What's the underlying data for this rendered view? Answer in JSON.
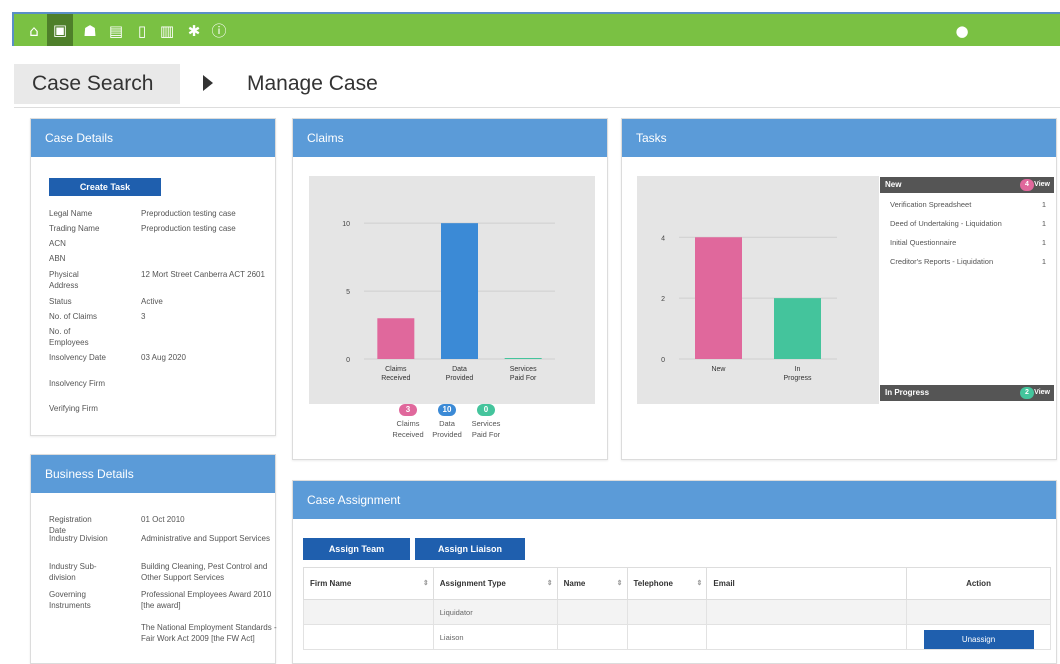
{
  "nav": {
    "icons": [
      "home-icon",
      "briefcase-icon",
      "users-icon",
      "id-card-icon",
      "document-icon",
      "bar-chart-icon",
      "settings-icon",
      "info-icon"
    ],
    "user_icon": "user-icon",
    "color": "#7ac143"
  },
  "breadcrumb": {
    "home": "Case Search",
    "current": "Manage Case"
  },
  "case_details": {
    "title": "Case Details",
    "create_task_label": "Create Task",
    "rows": [
      {
        "label": "Legal Name",
        "value": "Preproduction testing case"
      },
      {
        "label": "Trading Name",
        "value": "Preproduction testing case"
      },
      {
        "label": "ACN",
        "value": ""
      },
      {
        "label": "ABN",
        "value": ""
      },
      {
        "label": "Physical Address",
        "value": "12 Mort Street Canberra ACT 2601"
      },
      {
        "label": "Status",
        "value": "Active"
      },
      {
        "label": "No. of Claims",
        "value": "3"
      },
      {
        "label": "No. of Employees",
        "value": ""
      },
      {
        "label": "Insolvency Date",
        "value": "03 Aug 2020"
      },
      {
        "label": "Insolvency Firm",
        "value": ""
      },
      {
        "label": "Verifying Firm",
        "value": ""
      }
    ]
  },
  "business_details": {
    "title": "Business Details",
    "rows": [
      {
        "label": "Registration Date",
        "value": "01 Oct 2010"
      },
      {
        "label": "Industry Division",
        "value": "Administrative and Support Services"
      },
      {
        "label": "Industry Sub-division",
        "value": "Building Cleaning, Pest Control and Other Support Services"
      },
      {
        "label": "Governing Instruments",
        "value": "Professional Employees Award 2010 [the award]"
      },
      {
        "label": "",
        "value": "The National Employment Standards - Fair Work Act 2009 [the FW Act]"
      }
    ]
  },
  "claims": {
    "title": "Claims",
    "legend": [
      {
        "count": "3",
        "label": "Claims Received",
        "color": "#e0689c"
      },
      {
        "count": "10",
        "label": "Data Provided",
        "color": "#3b8ad6"
      },
      {
        "count": "0",
        "label": "Services Paid For",
        "color": "#44c49c"
      }
    ]
  },
  "tasks": {
    "title": "Tasks",
    "new_header": "New",
    "new_count": "4",
    "view_label": "View",
    "items": [
      {
        "name": "Verification Spreadsheet",
        "count": "1"
      },
      {
        "name": "Deed of Undertaking - Liquidation",
        "count": "1"
      },
      {
        "name": "Initial Questionnaire",
        "count": "1"
      },
      {
        "name": "Creditor's Reports - Liquidation",
        "count": "1"
      }
    ],
    "inprogress_header": "In Progress",
    "inprogress_count": "2"
  },
  "assignment": {
    "title": "Case Assignment",
    "assign_team_label": "Assign Team",
    "assign_liaison_label": "Assign Liaison",
    "columns": [
      "Firm Name",
      "Assignment Type",
      "Name",
      "Telephone",
      "Email",
      "Action"
    ],
    "rows": [
      {
        "firm": "",
        "type": "Liquidator",
        "name": "",
        "phone": "",
        "email": "",
        "action": ""
      },
      {
        "firm": "",
        "type": "Liaison",
        "name": "",
        "phone": "",
        "email": "",
        "action": "Unassign"
      }
    ]
  },
  "chart_data": [
    {
      "type": "bar",
      "title": "Claims",
      "categories": [
        "Claims Received",
        "Data Provided",
        "Services Paid For"
      ],
      "values": [
        3,
        10,
        0
      ],
      "colors": [
        "#e0689c",
        "#3b8ad6",
        "#44c49c"
      ],
      "yticks": [
        0,
        5,
        10
      ],
      "ylim": [
        0,
        12
      ],
      "grid": true
    },
    {
      "type": "bar",
      "title": "Tasks",
      "categories": [
        "New",
        "In Progress"
      ],
      "values": [
        4,
        2
      ],
      "colors": [
        "#e0689c",
        "#44c49c"
      ],
      "yticks": [
        0,
        2,
        4
      ],
      "ylim": [
        0,
        4.6
      ],
      "grid": true
    }
  ]
}
